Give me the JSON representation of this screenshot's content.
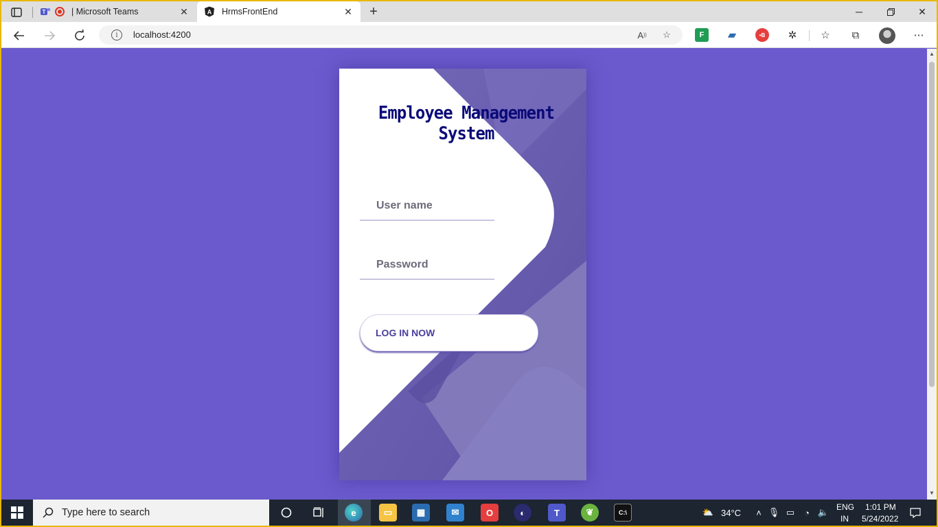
{
  "browser": {
    "tabs": [
      {
        "label": "| Microsoft Teams",
        "active": false
      },
      {
        "label": "HrmsFrontEnd",
        "active": true
      }
    ],
    "address": {
      "url": "localhost:4200"
    }
  },
  "page": {
    "background_color": "#6a5acd",
    "title": "Employee Management System",
    "username_placeholder": "User name",
    "password_placeholder": "Password",
    "login_label": "LOG IN NOW"
  },
  "taskbar": {
    "search_placeholder": "Type here to search",
    "weather": "34°C",
    "language_line1": "ENG",
    "language_line2": "IN",
    "time": "1:01 PM",
    "date": "5/24/2022"
  }
}
